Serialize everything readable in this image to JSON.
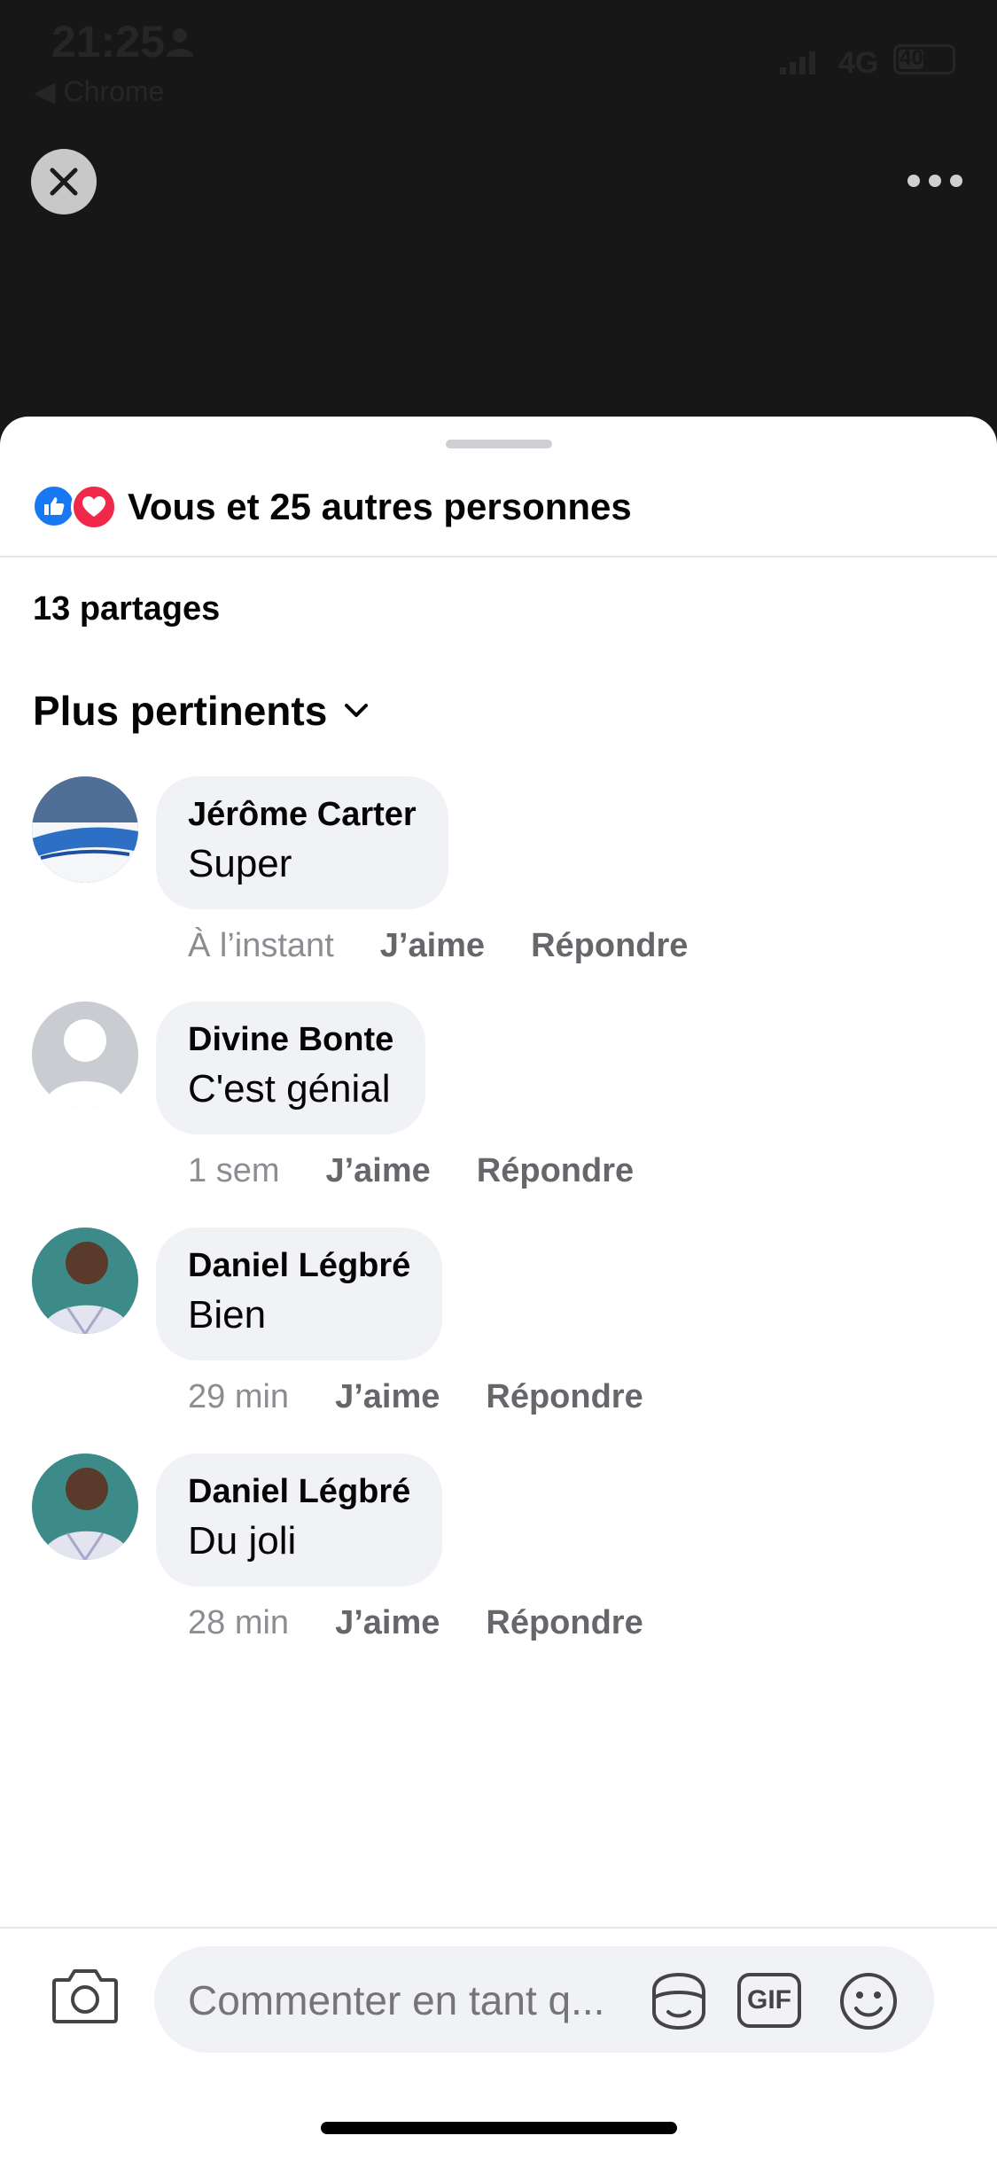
{
  "status_bar": {
    "time": "21:25",
    "back_app": "◀ Chrome",
    "network": "4G",
    "battery": "40"
  },
  "reactions": {
    "summary": "Vous et 25 autres personnes",
    "types": [
      "like-icon",
      "love-icon"
    ]
  },
  "shares": "13 partages",
  "sort": {
    "label": "Plus pertinents"
  },
  "comments": [
    {
      "author": "Jérôme Carter",
      "text": "Super",
      "time": "À l’instant",
      "like": "J’aime",
      "reply": "Répondre"
    },
    {
      "author": "Divine Bonte",
      "text": "C'est génial",
      "time": "1 sem",
      "like": "J’aime",
      "reply": "Répondre"
    },
    {
      "author": "Daniel Légbré",
      "text": "Bien",
      "time": "29 min",
      "like": "J’aime",
      "reply": "Répondre"
    },
    {
      "author": "Daniel Légbré",
      "text": "Du joli",
      "time": "28 min",
      "like": "J’aime",
      "reply": "Répondre"
    }
  ],
  "composer": {
    "placeholder": "Commenter en tant q...",
    "gif_label": "GIF"
  },
  "colors": {
    "accent": "#1877f2",
    "love": "#f0284a",
    "bubble": "#f0f2f5",
    "meta_text": "#65676b"
  }
}
